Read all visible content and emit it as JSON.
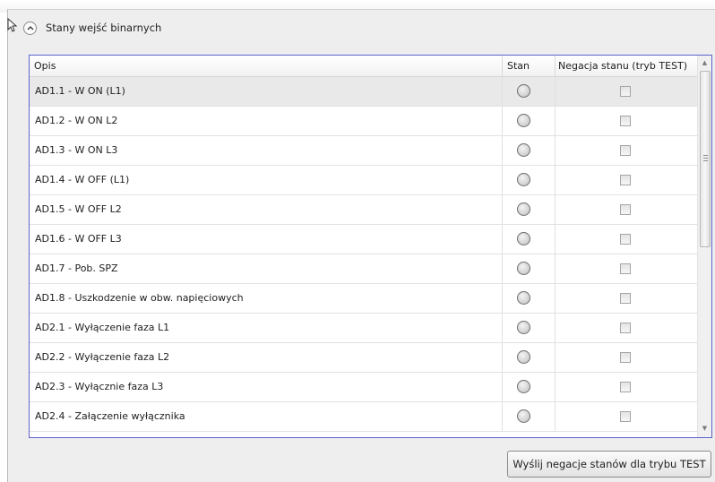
{
  "group": {
    "title": "Stany wejść binarnych"
  },
  "grid": {
    "columns": [
      "Opis",
      "Stan",
      "Negacja stanu (tryb TEST)"
    ],
    "rows": [
      {
        "opis": "AD1.1 - W ON (L1)",
        "stan": "off",
        "negacja": false
      },
      {
        "opis": "AD1.2 - W ON L2",
        "stan": "off",
        "negacja": false
      },
      {
        "opis": "AD1.3 - W ON L3",
        "stan": "off",
        "negacja": false
      },
      {
        "opis": "AD1.4 - W OFF (L1)",
        "stan": "off",
        "negacja": false
      },
      {
        "opis": "AD1.5 - W OFF L2",
        "stan": "off",
        "negacja": false
      },
      {
        "opis": "AD1.6 - W OFF L3",
        "stan": "off",
        "negacja": false
      },
      {
        "opis": "AD1.7 - Pob. SPZ",
        "stan": "off",
        "negacja": false
      },
      {
        "opis": "AD1.8 - Uszkodzenie w obw. napięciowych",
        "stan": "off",
        "negacja": false
      },
      {
        "opis": "AD2.1 - Wyłączenie faza L1",
        "stan": "off",
        "negacja": false
      },
      {
        "opis": "AD2.2 - Wyłączenie faza L2",
        "stan": "off",
        "negacja": false
      },
      {
        "opis": "AD2.3 - Wyłącznie faza L3",
        "stan": "off",
        "negacja": false
      },
      {
        "opis": "AD2.4 - Załączenie wyłącznika",
        "stan": "off",
        "negacja": false
      }
    ]
  },
  "footer": {
    "send_label": "Wyślij negacje stanów dla trybu TEST"
  },
  "icons": {
    "collapse": "chevron-up-icon",
    "led": "state-led-icon",
    "scroll_up": "scroll-up-arrow-icon",
    "scroll_down": "scroll-down-arrow-icon"
  },
  "colors": {
    "grid_border": "#5b62c9",
    "selected_row": "#e9e9e9",
    "window_bg": "#eeeeee"
  }
}
